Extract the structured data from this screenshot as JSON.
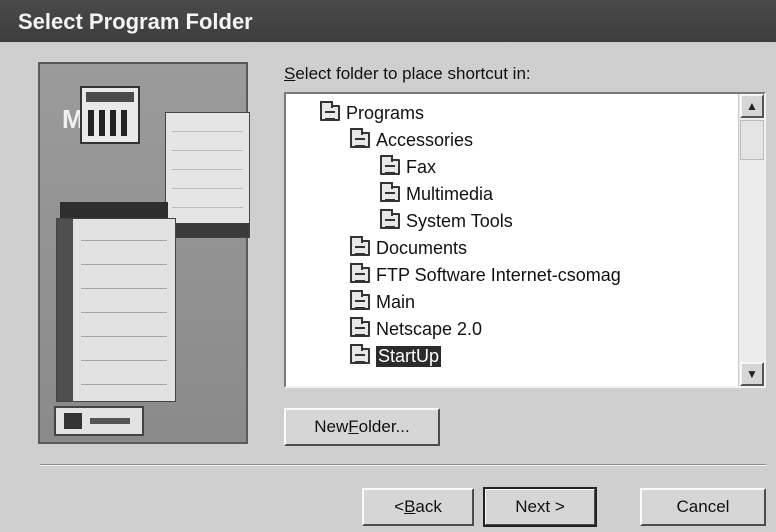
{
  "window": {
    "title": "Select Program Folder"
  },
  "prompt": {
    "prefix": "S",
    "rest": "elect folder to place shortcut in:"
  },
  "tree": {
    "items": [
      {
        "label": "Programs"
      },
      {
        "label": "Accessories"
      },
      {
        "label": "Fax"
      },
      {
        "label": "Multimedia"
      },
      {
        "label": "System Tools"
      },
      {
        "label": "Documents"
      },
      {
        "label": "FTP Software Internet-csomag"
      },
      {
        "label": "Main"
      },
      {
        "label": "Netscape 2.0"
      },
      {
        "label": "StartUp",
        "selected": true
      }
    ]
  },
  "buttons": {
    "new_folder": {
      "pre": "New ",
      "u": "F",
      "post": "older..."
    },
    "back": {
      "pre": "< ",
      "u": "B",
      "post": "ack"
    },
    "next": {
      "label": "Next >"
    },
    "cancel": {
      "label": "Cancel"
    }
  },
  "icons": {
    "tree_item": "folder-icon",
    "scroll_up": "arrow-up-icon",
    "scroll_down": "arrow-down-icon"
  }
}
